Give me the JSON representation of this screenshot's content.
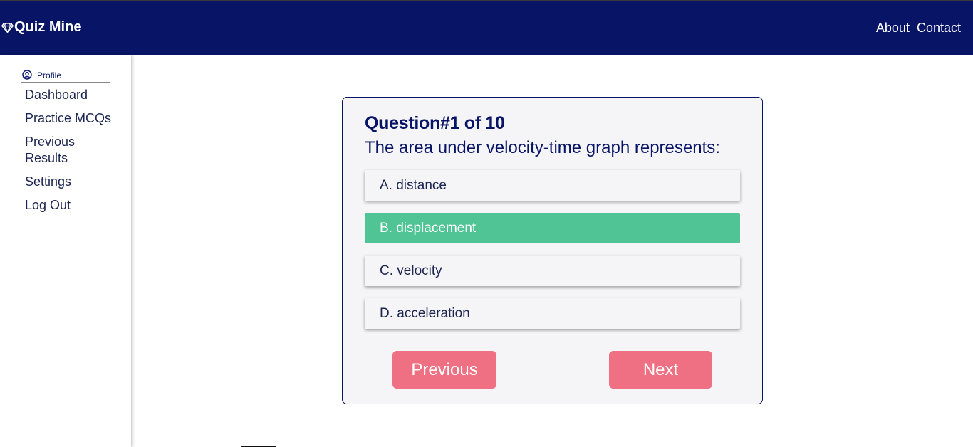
{
  "header": {
    "brand_name": "Quiz Mine",
    "brand_icon": "diamond-icon",
    "links": {
      "about": "About",
      "contact": "Contact"
    },
    "bg_color": "#081466"
  },
  "sidebar": {
    "profile_label": "Profile",
    "profile_icon": "user-circle-icon",
    "items": [
      {
        "label": "Dashboard"
      },
      {
        "label": "Practice MCQs"
      },
      {
        "label": "Previous Results"
      },
      {
        "label": "Settings"
      },
      {
        "label": "Log Out"
      }
    ]
  },
  "quiz": {
    "title": "Question#1 of 10",
    "question": "The area under velocity-time graph represents:",
    "options": [
      {
        "label": "A. distance",
        "selected": false
      },
      {
        "label": "B. displacement",
        "selected": true
      },
      {
        "label": "C. velocity",
        "selected": false
      },
      {
        "label": "D. acceleration",
        "selected": false
      }
    ],
    "selected_color": "#50c494",
    "previous_label": "Previous",
    "next_label": "Next",
    "button_color": "#ef7082"
  }
}
